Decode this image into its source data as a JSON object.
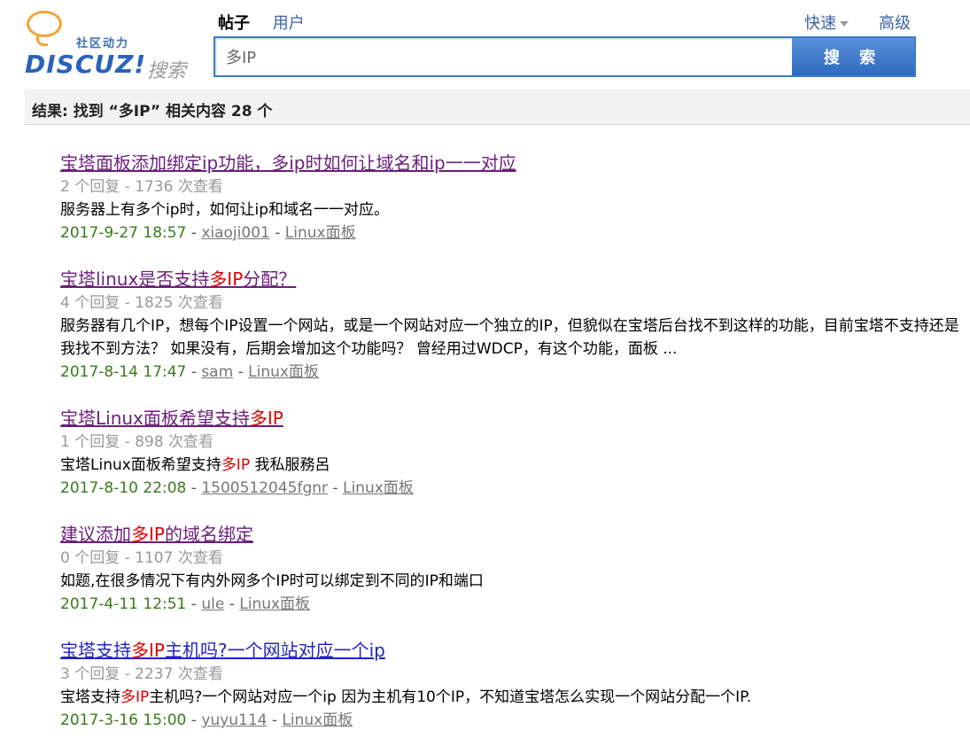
{
  "logo": {
    "tag": "社区动力",
    "brand": "DISCUZ!",
    "sub": "搜索"
  },
  "tabs": [
    {
      "label": "帖子"
    },
    {
      "label": "用户"
    }
  ],
  "quick": "快速",
  "advanced": "高级",
  "search": {
    "value": "多IP",
    "button": "搜 索"
  },
  "result_summary": "结果: 找到 “多IP” 相关内容 28 个",
  "colors": {
    "accent": "#3d7cc9",
    "highlight": "#e00000",
    "visited": "#6b1f7a",
    "link": "#2323c0",
    "date": "#3a7a1a"
  },
  "results": [
    {
      "title": [
        "宝塔面板添加绑定ip功能，多ip时如何让域名和ip一一对应"
      ],
      "meta": "2 个回复 - 1736 次查看",
      "snippet": [
        "服务器上有多个ip时，如何让ip和域名一一对应。"
      ],
      "date": "2017-9-27 18:57",
      "author": "xiaoji001",
      "forum": "Linux面板"
    },
    {
      "title": [
        "宝塔linux是否支持",
        "多IP",
        "分配？"
      ],
      "meta": "4 个回复 - 1825 次查看",
      "snippet": [
        "服务器有几个IP，想每个IP设置一个网站，或是一个网站对应一个独立的IP，但貌似在宝塔后台找不到这样的功能，目前宝塔不支持还是我找不到方法？ 如果没有，后期会增加这个功能吗？ 曾经用过WDCP，有这个功能，面板 ..."
      ],
      "date": "2017-8-14 17:47",
      "author": "sam",
      "forum": "Linux面板"
    },
    {
      "title": [
        "宝塔Linux面板希望支持",
        "多IP",
        ""
      ],
      "meta": "1 个回复 - 898 次查看",
      "snippet": [
        "宝塔Linux面板希望支持",
        "多IP",
        " 我私服務呂"
      ],
      "date": "2017-8-10 22:08",
      "author": "1500512045fgnr",
      "forum": "Linux面板"
    },
    {
      "title": [
        "建议添加",
        "多IP",
        "的域名绑定"
      ],
      "meta": "0 个回复 - 1107 次查看",
      "snippet": [
        "如题,在很多情况下有内外网多个IP时可以绑定到不同的IP和端口"
      ],
      "date": "2017-4-11 12:51",
      "author": "ule",
      "forum": "Linux面板"
    },
    {
      "title": [
        "宝塔支持",
        "多IP",
        "主机吗?一个网站对应一个ip"
      ],
      "meta": "3 个回复 - 2237 次查看",
      "snippet": [
        "宝塔支持",
        "多IP",
        "主机吗?一个网站对应一个ip 因为主机有10个IP，不知道宝塔怎么实现一个网站分配一个IP."
      ],
      "date": "2017-3-16 15:00",
      "author": "yuyu114",
      "forum": "Linux面板"
    }
  ]
}
